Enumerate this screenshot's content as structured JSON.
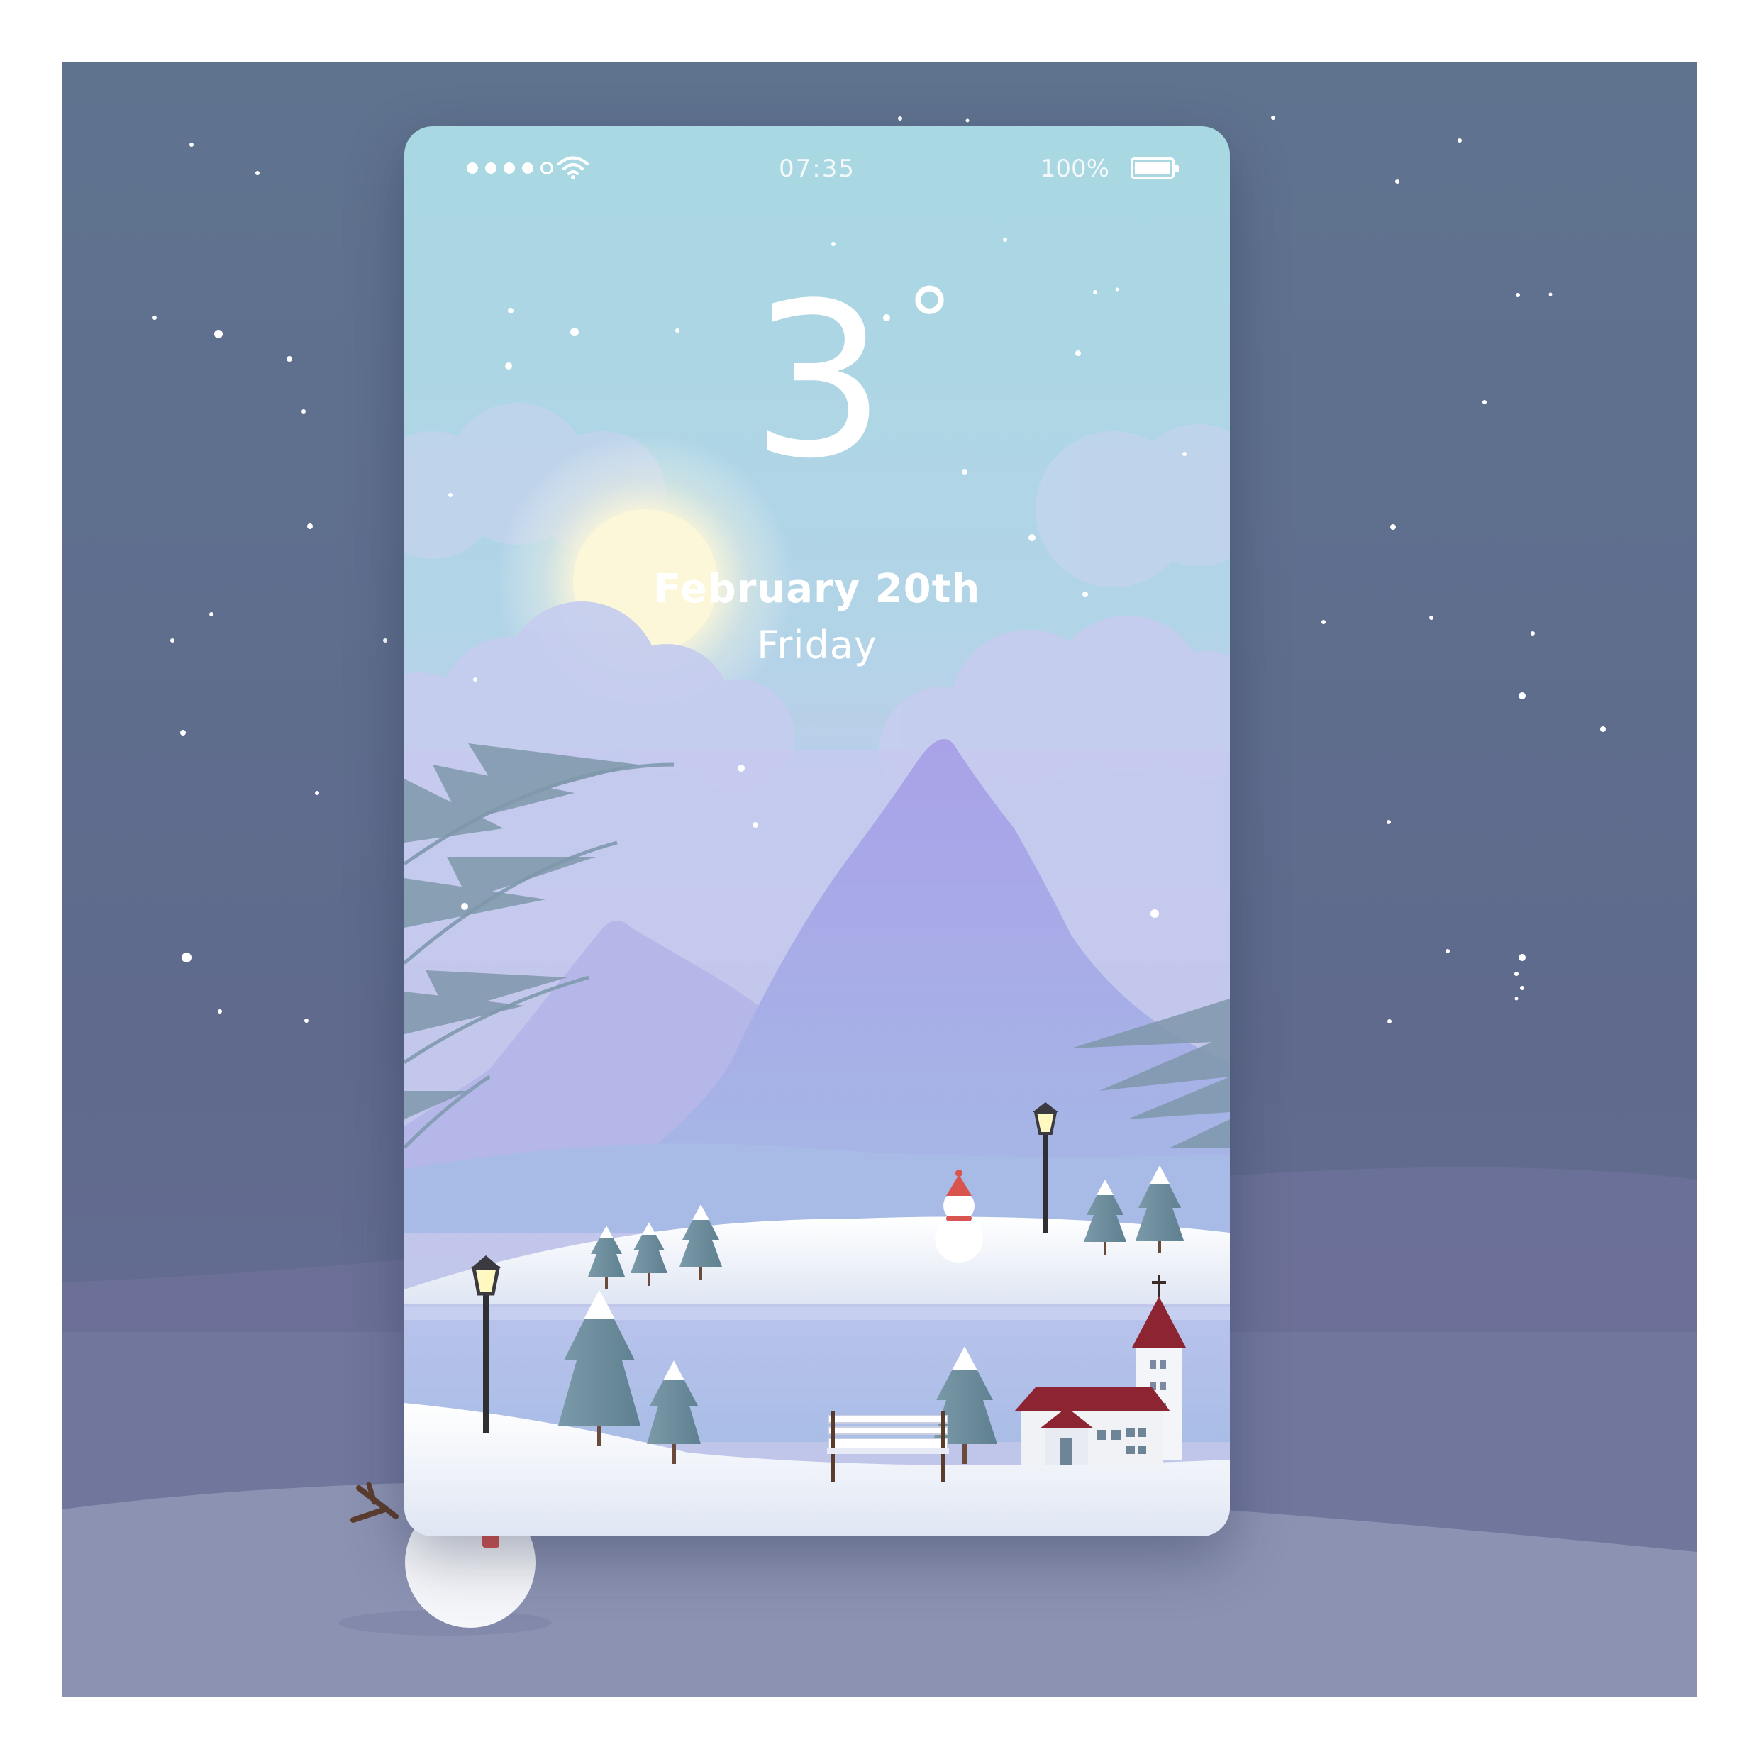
{
  "status_bar": {
    "signal_bars_filled": 4,
    "signal_bars_total": 5,
    "time": "07:35",
    "battery_percent": "100%"
  },
  "weather": {
    "temperature": "3",
    "degree_symbol": "°",
    "date": "February 20th",
    "weekday": "Friday"
  },
  "icons": {
    "wifi": "wifi-icon",
    "battery": "battery-icon",
    "signal": "signal-dots-icon"
  },
  "colors": {
    "scene_background": "#5f6f8d",
    "sky_top": "#a9d8e3",
    "sky_bottom": "#c8c9ef",
    "mountain": "#a8a8e6",
    "snow": "#eef2f8",
    "roof": "#8c2431"
  }
}
